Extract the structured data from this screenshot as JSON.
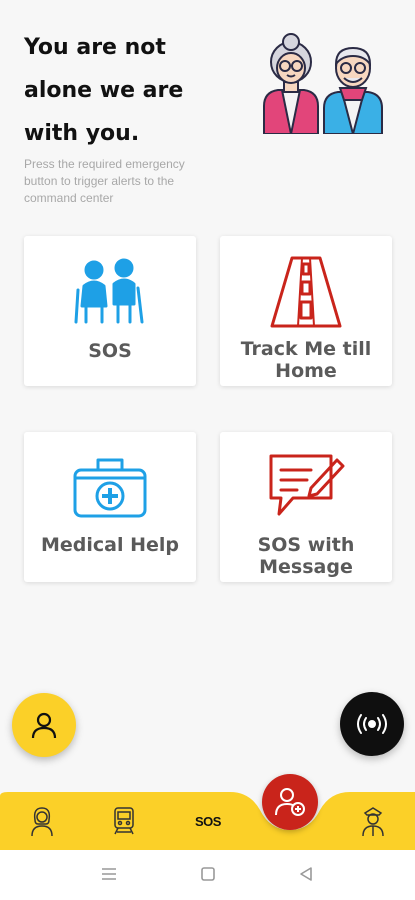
{
  "header": {
    "headline_line1": "You are not",
    "headline_line2": "alone we are",
    "headline_line3": "with you.",
    "subtext": "Press the required emergency button to trigger alerts to the command center"
  },
  "cards": {
    "sos": {
      "label": "SOS",
      "icon": "elderly-couple-icon"
    },
    "track": {
      "label_line1": "Track Me till",
      "label_line2": "Home",
      "icon": "road-icon"
    },
    "medical": {
      "label": "Medical Help",
      "icon": "medical-kit-icon"
    },
    "sos_message": {
      "label_line1": "SOS with",
      "label_line2": "Message",
      "icon": "message-edit-icon"
    }
  },
  "bottom_nav": {
    "sos_label": "SOS",
    "items": [
      "woman-avatar-icon",
      "train-icon",
      "sos-text",
      "add-user-icon",
      "officer-icon"
    ]
  },
  "colors": {
    "accent_yellow": "#fbd028",
    "blue_icon": "#1ea0e6",
    "red_icon": "#c9241b",
    "card_text": "#5a5a5a"
  }
}
